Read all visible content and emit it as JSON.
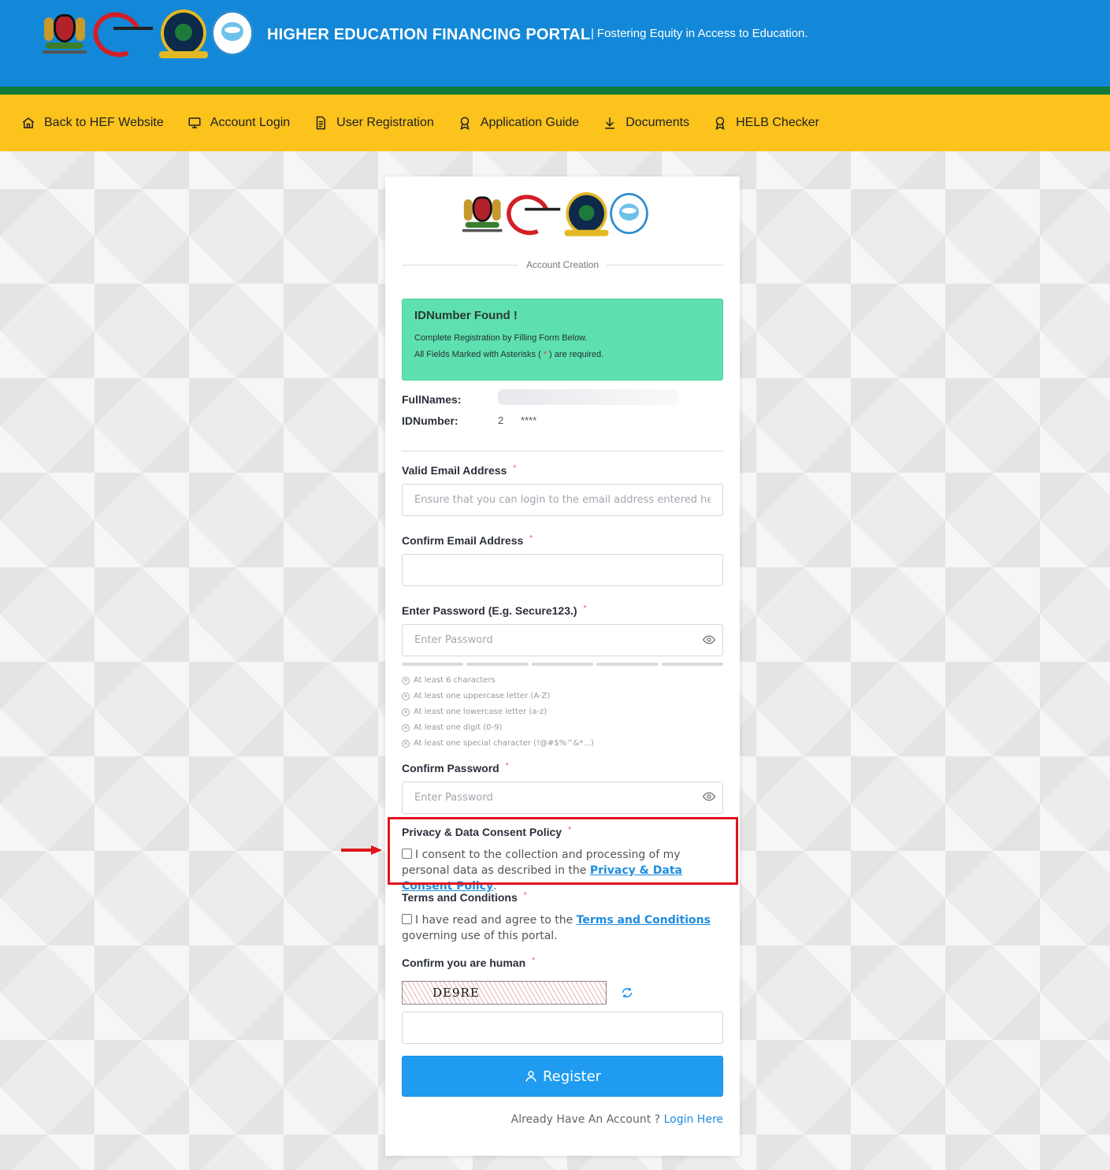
{
  "header": {
    "title": "HIGHER EDUCATION FINANCING PORTAL",
    "subtitle": "Fostering Equity in Access to Education.",
    "pipe": "|"
  },
  "nav": {
    "items": [
      {
        "label": "Back to HEF Website",
        "icon": "home-icon"
      },
      {
        "label": "Account Login",
        "icon": "monitor-icon"
      },
      {
        "label": "User Registration",
        "icon": "document-icon"
      },
      {
        "label": "Application Guide",
        "icon": "award-icon"
      },
      {
        "label": "Documents",
        "icon": "download-icon"
      },
      {
        "label": "HELB Checker",
        "icon": "award-icon"
      }
    ]
  },
  "card": {
    "section_title": "Account Creation",
    "alert": {
      "heading": "IDNumber Found !",
      "line1": "Complete Registration by Filling Form Below.",
      "line2_prefix": "All Fields Marked with Asterisks (",
      "line2_asterisk": "*",
      "line2_suffix": ") are required."
    },
    "fullnames_label": "FullNames:",
    "fullnames_value": "",
    "idnumber_label": "IDNumber:",
    "idnumber_value": "2      ****",
    "email": {
      "label": "Valid Email Address",
      "placeholder": "Ensure that you can login to the email address entered he"
    },
    "confirm_email": {
      "label": "Confirm Email Address",
      "placeholder": ""
    },
    "password": {
      "label": "Enter Password (E.g. Secure123.)",
      "placeholder": "Enter Password"
    },
    "password_rules": [
      "At least 6 characters",
      "At least one uppercase letter (A-Z)",
      "At least one lowercase letter (a-z)",
      "At least one digit (0-9)",
      "At least one special character (!@#$%^&*...)"
    ],
    "confirm_password": {
      "label": "Confirm Password",
      "placeholder": "Enter Password"
    },
    "privacy": {
      "label": "Privacy & Data Consent Policy",
      "text": "I consent to the collection and processing of my personal data as described in the",
      "link": "Privacy & Data Consent Policy",
      "suffix": "."
    },
    "terms": {
      "label": "Terms and Conditions",
      "text": "I have read and agree to the",
      "link": "Terms and Conditions",
      "suffix": "governing use of this portal."
    },
    "captcha": {
      "label": "Confirm you are human",
      "code": "DE9RE",
      "placeholder": ""
    },
    "register_label": "Register",
    "already_text": "Already Have An Account ?",
    "login_link": "Login Here",
    "required_mark": "*"
  },
  "colors": {
    "header_blue": "#1388d8",
    "nav_yellow": "#fbc31c",
    "green_stripe": "#0f7a36",
    "alert_green": "#5fe0b0",
    "primary_button": "#1f9cf0",
    "highlight_red": "#e0141b"
  }
}
